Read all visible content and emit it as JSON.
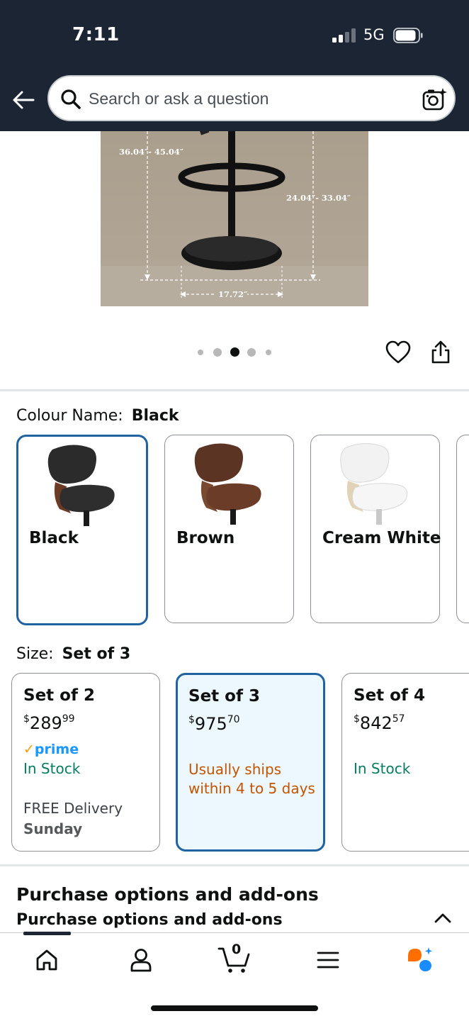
{
  "status_bar": {
    "time": "7:11",
    "network": "5G"
  },
  "search": {
    "placeholder": "Search or ask a question"
  },
  "product_image": {
    "dimension_height": "36.04″- 45.04″",
    "dimension_seat": "24.04″- 33.04″",
    "dimension_base": "17.72″",
    "carousel_total": 5,
    "carousel_active": 3
  },
  "colour": {
    "label": "Colour Name:",
    "selected": "Black",
    "options": [
      {
        "name": "Black",
        "selected": true
      },
      {
        "name": "Brown",
        "selected": false
      },
      {
        "name": "Cream White",
        "selected": false
      }
    ]
  },
  "size": {
    "label": "Size:",
    "selected": "Set of 3",
    "options": [
      {
        "name": "Set of 2",
        "currency": "$",
        "price_whole": "289",
        "price_fraction": "99",
        "prime": "prime",
        "stock": "In Stock",
        "delivery": "FREE Delivery",
        "delivery_day": "Sunday",
        "selected": false
      },
      {
        "name": "Set of 3",
        "currency": "$",
        "price_whole": "975",
        "price_fraction": "70",
        "ships": "Usually ships within 4 to 5 days",
        "selected": true
      },
      {
        "name": "Set of 4",
        "currency": "$",
        "price_whole": "842",
        "price_fraction": "57",
        "stock": "In Stock",
        "selected": false
      }
    ]
  },
  "purchase_options": {
    "title": "Purchase options and add-ons",
    "subtitle": "Purchase options and add-ons"
  },
  "bottom_nav": {
    "items": [
      "home-icon",
      "account-icon",
      "cart-icon",
      "menu-icon",
      "rufus-icon"
    ],
    "cart_count": "0"
  },
  "colors": {
    "header_bg": "#1b2533",
    "selected_border": "#2162a1",
    "in_stock": "#067d62",
    "ships_orange": "#c45500",
    "prime_blue": "#1a98ff"
  }
}
